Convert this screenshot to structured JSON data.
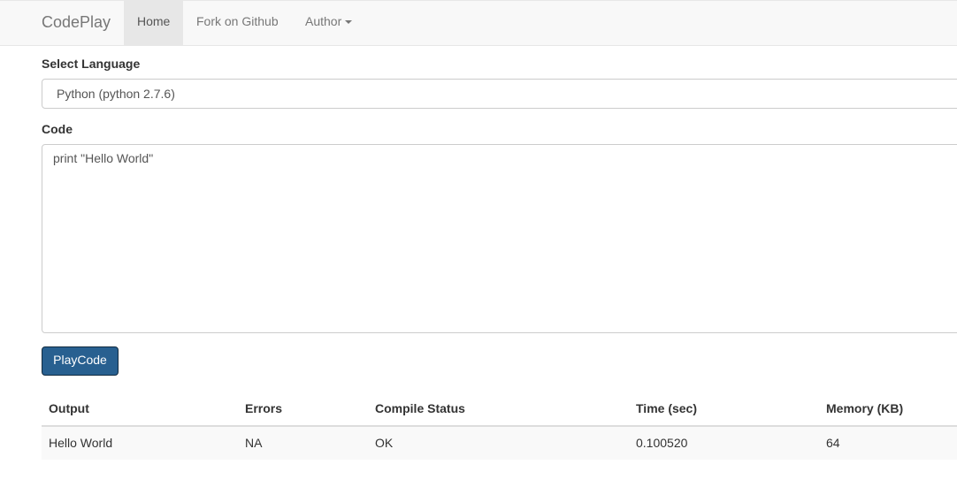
{
  "navbar": {
    "brand": "CodePlay",
    "items": [
      {
        "label": "Home"
      },
      {
        "label": "Fork on Github"
      },
      {
        "label": "Author"
      }
    ]
  },
  "form": {
    "language_label": "Select Language",
    "language_value": "Python (python 2.7.6)",
    "code_label": "Code",
    "code_value": "print \"Hello World\"",
    "run_button": "PlayCode"
  },
  "results": {
    "headers": [
      "Output",
      "Errors",
      "Compile Status",
      "Time (sec)",
      "Memory (KB)"
    ],
    "rows": [
      [
        "Hello World",
        "NA",
        "OK",
        "0.100520",
        "64"
      ]
    ]
  }
}
